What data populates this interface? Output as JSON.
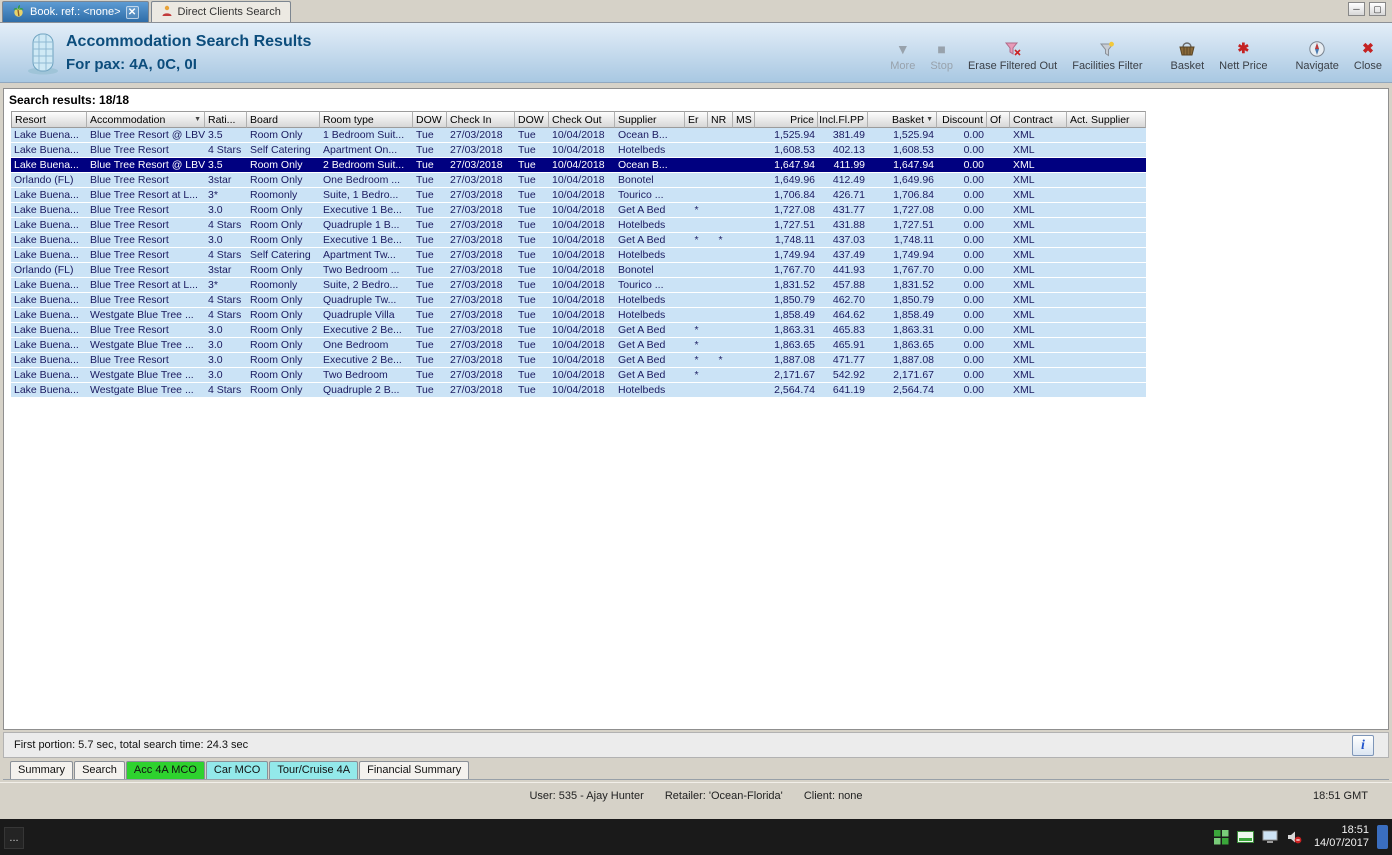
{
  "window": {
    "tabs": [
      {
        "label": "Book. ref.: <none>",
        "icon": "palm-tree",
        "active": true,
        "closable": true
      },
      {
        "label": "Direct Clients Search",
        "icon": "person",
        "active": false,
        "closable": false
      }
    ],
    "controls": {
      "minimize": "─",
      "maximize": "▢"
    }
  },
  "header": {
    "title": "Accommodation Search Results",
    "subtitle": "For pax: 4A, 0C, 0I",
    "toolbar": [
      {
        "label": "More",
        "disabled": true
      },
      {
        "label": "Stop",
        "disabled": true
      },
      {
        "label": "Erase Filtered Out",
        "disabled": false
      },
      {
        "label": "Facilities Filter",
        "disabled": false
      },
      {
        "label": "Basket",
        "disabled": false
      },
      {
        "label": "Nett Price",
        "disabled": false
      },
      {
        "label": "Navigate",
        "disabled": false
      },
      {
        "label": "Close",
        "disabled": false
      }
    ]
  },
  "results": {
    "summary": "Search results: 18/18",
    "selected_index": 2,
    "columns": [
      {
        "label": "Resort"
      },
      {
        "label": "Accommodation",
        "icon": "filter"
      },
      {
        "label": "Rati..."
      },
      {
        "label": "Board"
      },
      {
        "label": "Room type"
      },
      {
        "label": "DOW"
      },
      {
        "label": "Check In"
      },
      {
        "label": "DOW"
      },
      {
        "label": "Check Out"
      },
      {
        "label": "Supplier"
      },
      {
        "label": "Er"
      },
      {
        "label": "NR"
      },
      {
        "label": "MS"
      },
      {
        "label": "Price"
      },
      {
        "label": "Incl.Fl.PP"
      },
      {
        "label": "Basket",
        "icon": "sort"
      },
      {
        "label": "Discount"
      },
      {
        "label": "Of"
      },
      {
        "label": "Contract"
      },
      {
        "label": "Act. Supplier"
      }
    ],
    "rows": [
      [
        "Lake Buena...",
        "Blue Tree Resort @ LBV",
        "3.5",
        "Room Only",
        "1 Bedroom Suit...",
        "Tue",
        "27/03/2018",
        "Tue",
        "10/04/2018",
        "Ocean B...",
        "",
        "",
        "",
        "1,525.94",
        "381.49",
        "1,525.94",
        "0.00",
        "",
        "XML",
        ""
      ],
      [
        "Lake Buena...",
        "Blue Tree Resort",
        "4 Stars",
        "Self Catering",
        "Apartment On...",
        "Tue",
        "27/03/2018",
        "Tue",
        "10/04/2018",
        "Hotelbeds",
        "",
        "",
        "",
        "1,608.53",
        "402.13",
        "1,608.53",
        "0.00",
        "",
        "XML",
        ""
      ],
      [
        "Lake Buena...",
        "Blue Tree Resort @ LBV",
        "3.5",
        "Room Only",
        "2 Bedroom Suit...",
        "Tue",
        "27/03/2018",
        "Tue",
        "10/04/2018",
        "Ocean B...",
        "",
        "",
        "",
        "1,647.94",
        "411.99",
        "1,647.94",
        "0.00",
        "",
        "XML",
        ""
      ],
      [
        "Orlando (FL)",
        "Blue Tree Resort",
        "3star",
        "Room Only",
        "One Bedroom ...",
        "Tue",
        "27/03/2018",
        "Tue",
        "10/04/2018",
        "Bonotel",
        "",
        "",
        "",
        "1,649.96",
        "412.49",
        "1,649.96",
        "0.00",
        "",
        "XML",
        ""
      ],
      [
        "Lake Buena...",
        "Blue Tree Resort at L...",
        "3*",
        "Roomonly",
        "Suite, 1 Bedro...",
        "Tue",
        "27/03/2018",
        "Tue",
        "10/04/2018",
        "Tourico ...",
        "",
        "",
        "",
        "1,706.84",
        "426.71",
        "1,706.84",
        "0.00",
        "",
        "XML",
        ""
      ],
      [
        "Lake Buena...",
        "Blue Tree Resort",
        "3.0",
        "Room Only",
        "Executive 1 Be...",
        "Tue",
        "27/03/2018",
        "Tue",
        "10/04/2018",
        "Get A Bed",
        "*",
        "",
        "",
        "1,727.08",
        "431.77",
        "1,727.08",
        "0.00",
        "",
        "XML",
        ""
      ],
      [
        "Lake Buena...",
        "Blue Tree Resort",
        "4 Stars",
        "Room Only",
        "Quadruple 1 B...",
        "Tue",
        "27/03/2018",
        "Tue",
        "10/04/2018",
        "Hotelbeds",
        "",
        "",
        "",
        "1,727.51",
        "431.88",
        "1,727.51",
        "0.00",
        "",
        "XML",
        ""
      ],
      [
        "Lake Buena...",
        "Blue Tree Resort",
        "3.0",
        "Room Only",
        "Executive 1 Be...",
        "Tue",
        "27/03/2018",
        "Tue",
        "10/04/2018",
        "Get A Bed",
        "*",
        "*",
        "",
        "1,748.11",
        "437.03",
        "1,748.11",
        "0.00",
        "",
        "XML",
        ""
      ],
      [
        "Lake Buena...",
        "Blue Tree Resort",
        "4 Stars",
        "Self Catering",
        "Apartment Tw...",
        "Tue",
        "27/03/2018",
        "Tue",
        "10/04/2018",
        "Hotelbeds",
        "",
        "",
        "",
        "1,749.94",
        "437.49",
        "1,749.94",
        "0.00",
        "",
        "XML",
        ""
      ],
      [
        "Orlando (FL)",
        "Blue Tree Resort",
        "3star",
        "Room Only",
        "Two Bedroom ...",
        "Tue",
        "27/03/2018",
        "Tue",
        "10/04/2018",
        "Bonotel",
        "",
        "",
        "",
        "1,767.70",
        "441.93",
        "1,767.70",
        "0.00",
        "",
        "XML",
        ""
      ],
      [
        "Lake Buena...",
        "Blue Tree Resort at L...",
        "3*",
        "Roomonly",
        "Suite, 2 Bedro...",
        "Tue",
        "27/03/2018",
        "Tue",
        "10/04/2018",
        "Tourico ...",
        "",
        "",
        "",
        "1,831.52",
        "457.88",
        "1,831.52",
        "0.00",
        "",
        "XML",
        ""
      ],
      [
        "Lake Buena...",
        "Blue Tree Resort",
        "4 Stars",
        "Room Only",
        "Quadruple Tw...",
        "Tue",
        "27/03/2018",
        "Tue",
        "10/04/2018",
        "Hotelbeds",
        "",
        "",
        "",
        "1,850.79",
        "462.70",
        "1,850.79",
        "0.00",
        "",
        "XML",
        ""
      ],
      [
        "Lake Buena...",
        "Westgate Blue Tree ...",
        "4 Stars",
        "Room Only",
        "Quadruple Villa",
        "Tue",
        "27/03/2018",
        "Tue",
        "10/04/2018",
        "Hotelbeds",
        "",
        "",
        "",
        "1,858.49",
        "464.62",
        "1,858.49",
        "0.00",
        "",
        "XML",
        ""
      ],
      [
        "Lake Buena...",
        "Blue Tree Resort",
        "3.0",
        "Room Only",
        "Executive 2 Be...",
        "Tue",
        "27/03/2018",
        "Tue",
        "10/04/2018",
        "Get A Bed",
        "*",
        "",
        "",
        "1,863.31",
        "465.83",
        "1,863.31",
        "0.00",
        "",
        "XML",
        ""
      ],
      [
        "Lake Buena...",
        "Westgate Blue Tree ...",
        "3.0",
        "Room Only",
        "One Bedroom",
        "Tue",
        "27/03/2018",
        "Tue",
        "10/04/2018",
        "Get A Bed",
        "*",
        "",
        "",
        "1,863.65",
        "465.91",
        "1,863.65",
        "0.00",
        "",
        "XML",
        ""
      ],
      [
        "Lake Buena...",
        "Blue Tree Resort",
        "3.0",
        "Room Only",
        "Executive 2 Be...",
        "Tue",
        "27/03/2018",
        "Tue",
        "10/04/2018",
        "Get A Bed",
        "*",
        "*",
        "",
        "1,887.08",
        "471.77",
        "1,887.08",
        "0.00",
        "",
        "XML",
        ""
      ],
      [
        "Lake Buena...",
        "Westgate Blue Tree ...",
        "3.0",
        "Room Only",
        "Two Bedroom",
        "Tue",
        "27/03/2018",
        "Tue",
        "10/04/2018",
        "Get A Bed",
        "*",
        "",
        "",
        "2,171.67",
        "542.92",
        "2,171.67",
        "0.00",
        "",
        "XML",
        ""
      ],
      [
        "Lake Buena...",
        "Westgate Blue Tree ...",
        "4 Stars",
        "Room Only",
        "Quadruple 2 B...",
        "Tue",
        "27/03/2018",
        "Tue",
        "10/04/2018",
        "Hotelbeds",
        "",
        "",
        "",
        "2,564.74",
        "641.19",
        "2,564.74",
        "0.00",
        "",
        "XML",
        ""
      ]
    ]
  },
  "status_bar": {
    "text": "First portion: 5.7 sec, total search time: 24.3 sec",
    "info_label": "i"
  },
  "bottom_tabs": {
    "summary": "Summary",
    "search": "Search",
    "acc": "Acc 4A MCO",
    "car": "Car MCO",
    "tour": "Tour/Cruise 4A",
    "financial": "Financial Summary"
  },
  "session_bar": {
    "user": "User: 535 - Ajay Hunter",
    "retailer": "Retailer: 'Ocean-Florida'",
    "client": "Client: none",
    "gmt_time": "18:51 GMT"
  },
  "taskbar": {
    "overflow": "...",
    "clock_time": "18:51",
    "clock_date": "14/07/2017"
  },
  "colors": {
    "selected_row": "#000080",
    "row_background": "#cbe3f6",
    "acc_tab_green": "#2ed22e",
    "car_tour_cyan": "#93e9ea",
    "title_accent": "#0c4d7c"
  }
}
